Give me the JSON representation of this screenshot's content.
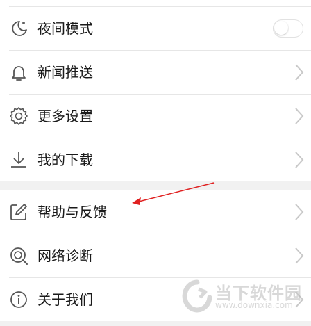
{
  "menu_top": [
    {
      "label": "夜间模式",
      "icon": "moon-icon",
      "control": "toggle",
      "toggle_on": false
    },
    {
      "label": "新闻推送",
      "icon": "bell-icon",
      "control": "chevron"
    },
    {
      "label": "更多设置",
      "icon": "gear-icon",
      "control": "chevron"
    },
    {
      "label": "我的下载",
      "icon": "download-icon",
      "control": "chevron"
    }
  ],
  "menu_bottom": [
    {
      "label": "帮助与反馈",
      "icon": "edit-icon",
      "control": "chevron"
    },
    {
      "label": "网络诊断",
      "icon": "network-diagnose-icon",
      "control": "chevron"
    },
    {
      "label": "关于我们",
      "icon": "info-icon",
      "control": "chevron"
    }
  ],
  "annotation": {
    "color": "#e02020"
  },
  "watermark": {
    "title": "当下软件园",
    "url": "www.downxia.com"
  },
  "colors": {
    "icon": "#555555",
    "chevron": "#c8c8c8",
    "section_gap": "#f1f1f1"
  }
}
